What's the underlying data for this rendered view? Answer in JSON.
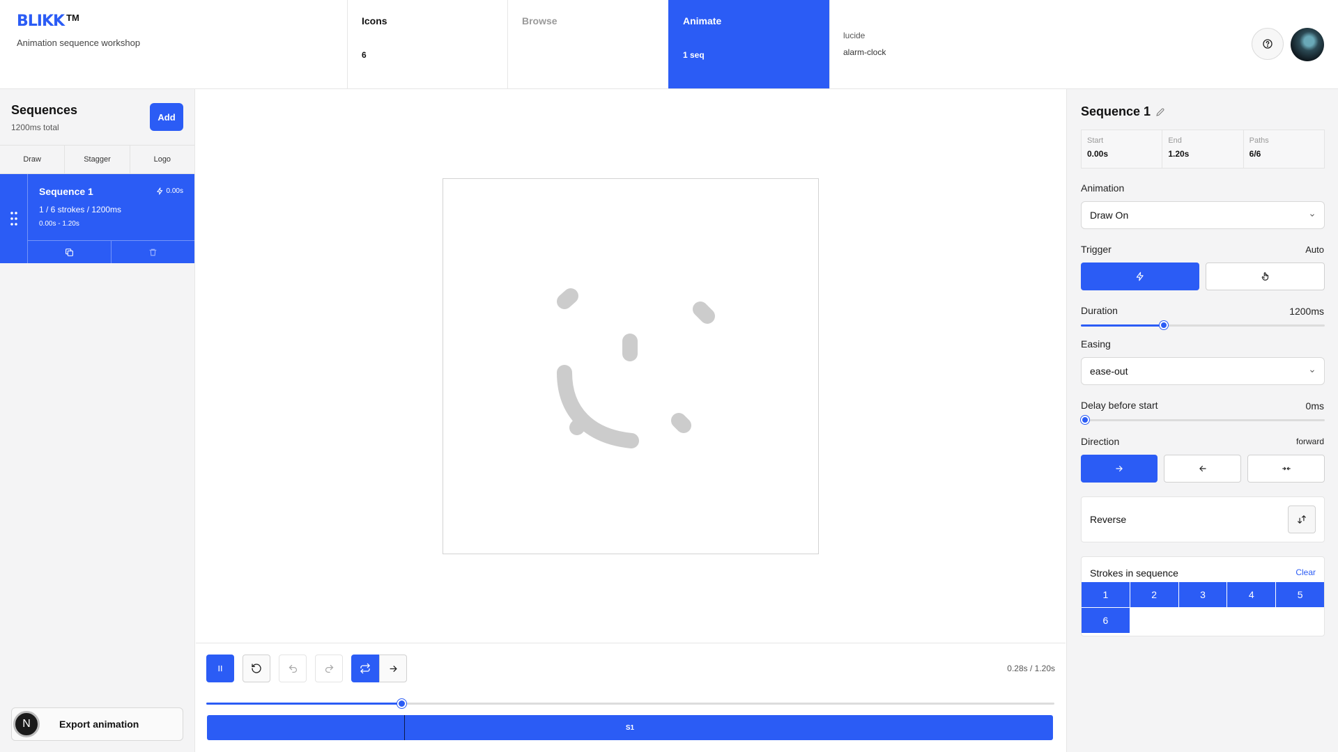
{
  "brand": {
    "logo": "BLIKK",
    "tm": "TM",
    "subtitle": "Animation sequence workshop"
  },
  "header_tabs": [
    {
      "title": "Icons",
      "sub": "6"
    },
    {
      "title": "Browse",
      "sub": ""
    },
    {
      "title": "Animate",
      "sub": "1 seq"
    }
  ],
  "header_info": {
    "library": "lucide",
    "icon": "alarm-clock"
  },
  "sidebar": {
    "title": "Sequences",
    "subtitle": "1200ms total",
    "add_label": "Add",
    "tabs": [
      "Draw",
      "Stagger",
      "Logo"
    ],
    "sequence": {
      "name": "Sequence 1",
      "trigger_time": "0.00s",
      "strokes": "1 / 6 strokes / 1200ms",
      "range": "0.00s - 1.20s"
    },
    "export_badge": "N",
    "export_label": "Export animation"
  },
  "playback": {
    "time": "0.28s / 1.20s",
    "progress": 0.233,
    "timeline_label": "S1"
  },
  "panel": {
    "title": "Sequence 1",
    "stats": [
      {
        "key": "Start",
        "value": "0.00s"
      },
      {
        "key": "End",
        "value": "1.20s"
      },
      {
        "key": "Paths",
        "value": "6/6"
      }
    ],
    "animation_label": "Animation",
    "animation_value": "Draw On",
    "trigger_label": "Trigger",
    "trigger_value": "Auto",
    "duration_label": "Duration",
    "duration_value": "1200ms",
    "duration_fraction": 0.34,
    "easing_label": "Easing",
    "easing_value": "ease-out",
    "delay_label": "Delay before start",
    "delay_value": "0ms",
    "delay_fraction": 0.0,
    "direction_label": "Direction",
    "direction_value": "forward",
    "reverse_label": "Reverse",
    "strokes_label": "Strokes in sequence",
    "clear_label": "Clear",
    "stroke_numbers": [
      "1",
      "2",
      "3",
      "4",
      "5",
      "6"
    ]
  },
  "colors": {
    "accent": "#2b5cf5",
    "stroke_gray": "#cccccc"
  },
  "icons": [
    "help-icon",
    "zap-icon",
    "hand-pointer-icon",
    "copy-icon",
    "trash-icon",
    "pencil-icon",
    "grip-icon",
    "pause-icon",
    "reset-icon",
    "undo-icon",
    "redo-icon",
    "loop-icon",
    "arrow-right-icon",
    "arrow-left-icon",
    "arrows-inward-icon",
    "swap-icon",
    "chevron-down-icon"
  ]
}
